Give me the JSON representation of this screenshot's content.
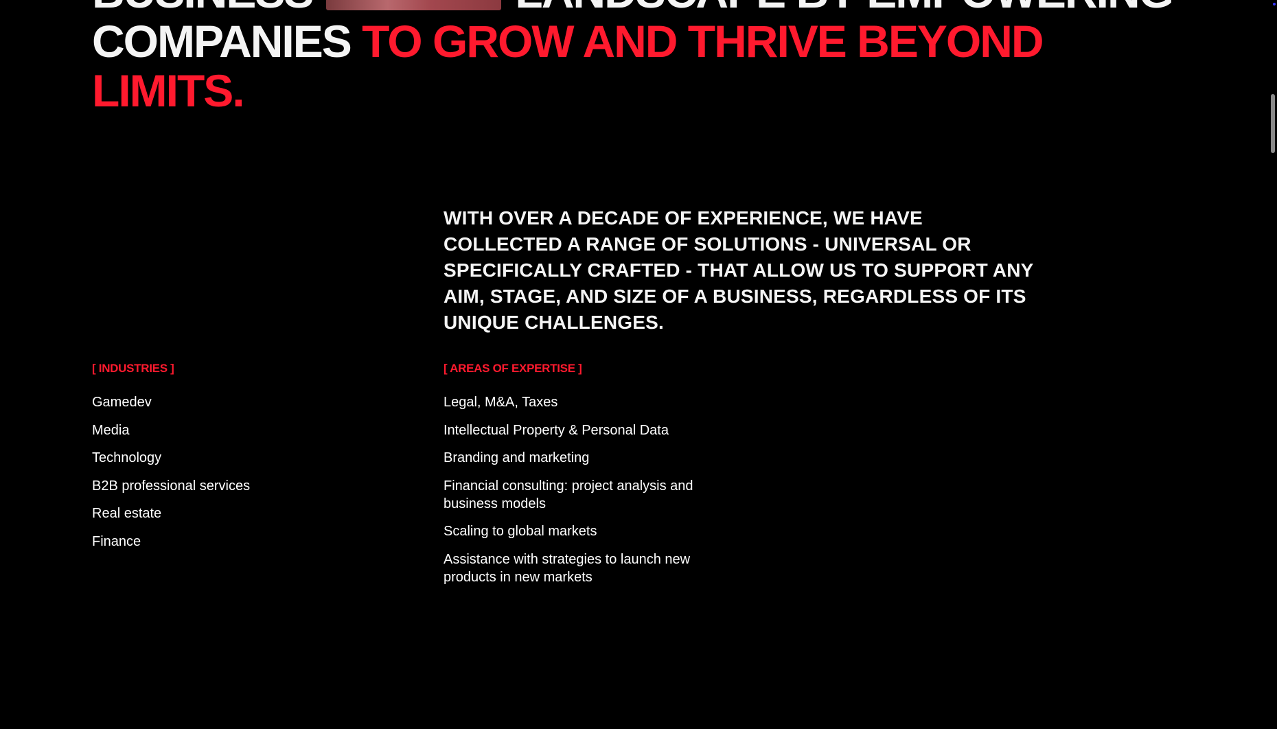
{
  "hero": {
    "line1_start": "BUSINESS",
    "line1_end": "LANDSCAPE BY EMPOWERING",
    "line2_white": "COMPANIES",
    "line2_red": "TO GROW AND THRIVE BEYOND",
    "line3_red": "LIMITS."
  },
  "intro": "WITH OVER A DECADE OF EXPERIENCE, WE HAVE COLLECTED A RANGE OF SOLUTIONS - UNIVERSAL OR SPECIFICALLY CRAFTED - THAT ALLOW US TO SUPPORT ANY AIM, STAGE, AND SIZE OF A BUSINESS, REGARDLESS OF ITS UNIQUE CHALLENGES.",
  "industries": {
    "label": "[ INDUSTRIES ]",
    "items": [
      "Gamedev",
      "Media",
      "Technology",
      "B2B professional services",
      "Real estate",
      "Finance"
    ]
  },
  "expertise": {
    "label": "[ AREAS OF EXPERTISE ]",
    "items": [
      "Legal, M&A, Taxes",
      "Intellectual Property & Personal Data",
      "Branding and marketing",
      "Financial consulting: project analysis and business models",
      "Scaling to global markets",
      "Assistance with strategies to launch new products in new markets"
    ]
  },
  "colors": {
    "background": "#000000",
    "text": "#ffffff",
    "accent": "#ff1a2e"
  }
}
